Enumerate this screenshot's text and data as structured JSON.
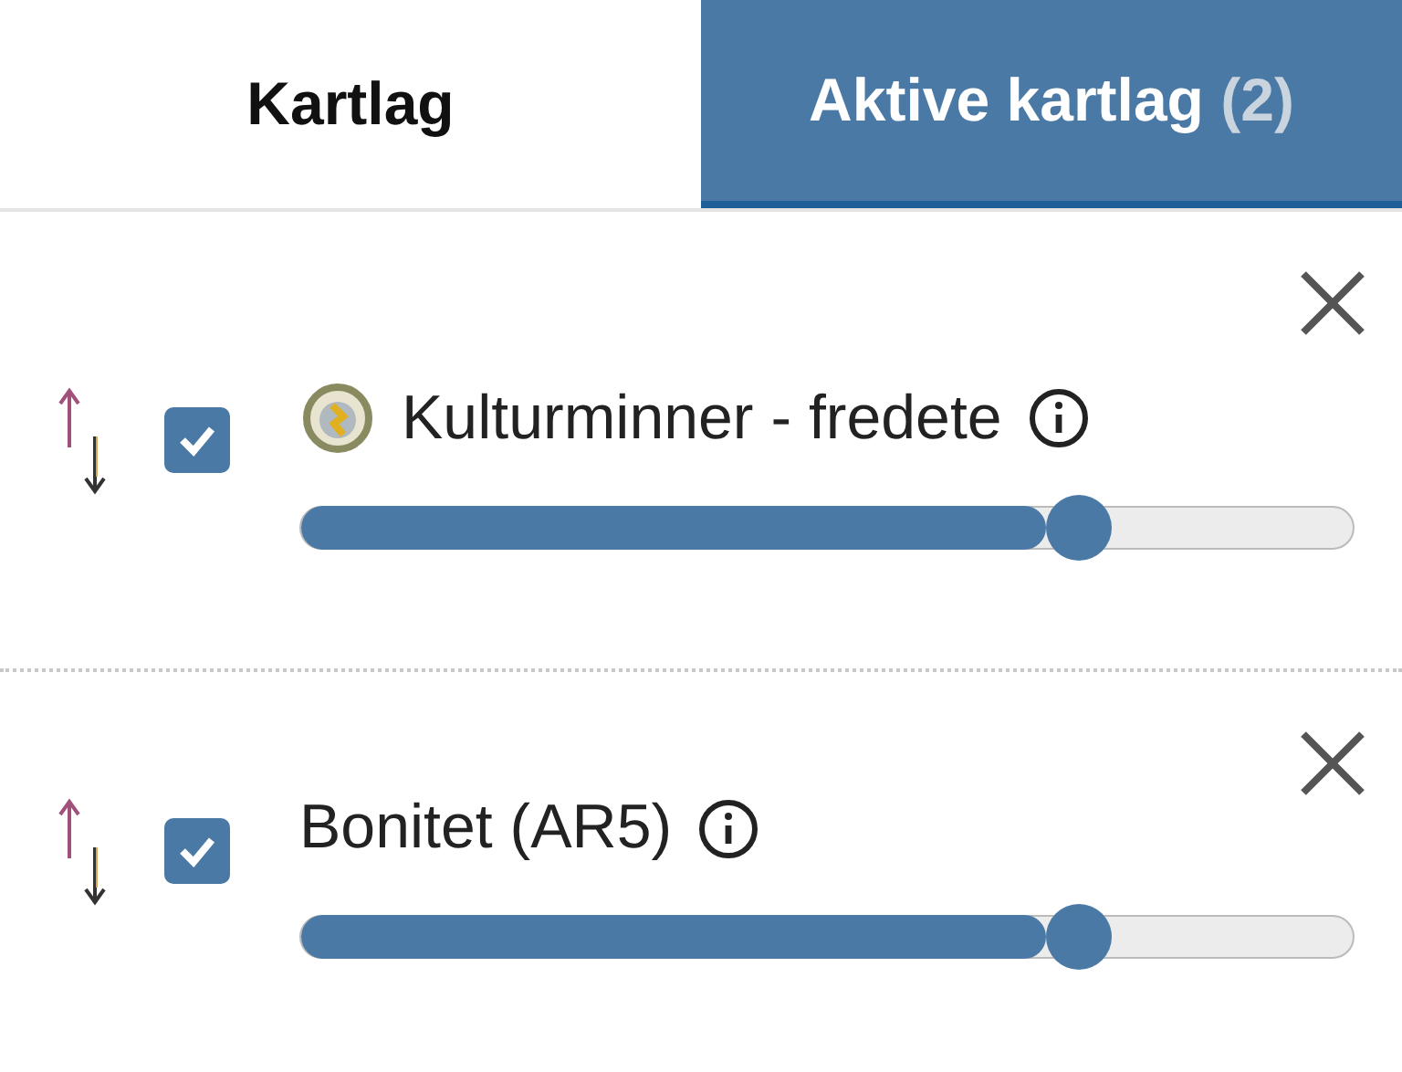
{
  "tabs": [
    {
      "label": "Kartlag",
      "selected": false
    },
    {
      "label": "Aktive kartlag",
      "count": "(2)",
      "selected": true
    }
  ],
  "layers": [
    {
      "name": "Kulturminner - fredete",
      "symbol": true,
      "checked": true,
      "level": 0.74
    },
    {
      "name": "Bonitet (AR5)",
      "symbol": false,
      "checked": true,
      "level": 0.74
    }
  ]
}
